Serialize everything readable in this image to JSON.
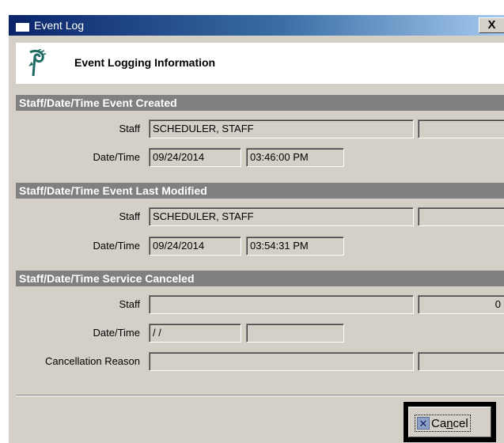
{
  "window": {
    "title": "Event Log",
    "close_label": "X"
  },
  "header": {
    "title": "Event Logging Information"
  },
  "sections": [
    {
      "title": "Staff/Date/Time Event Created",
      "staff_label": "Staff",
      "staff_value": "SCHEDULER, STAFF",
      "staff_extra": "",
      "datetime_label": "Date/Time",
      "date_value": "09/24/2014",
      "time_value": "03:46:00 PM"
    },
    {
      "title": "Staff/Date/Time Event Last Modified",
      "staff_label": "Staff",
      "staff_value": "SCHEDULER, STAFF",
      "staff_extra": "",
      "datetime_label": "Date/Time",
      "date_value": "09/24/2014",
      "time_value": "03:54:31 PM"
    },
    {
      "title": "Staff/Date/Time Service Canceled",
      "staff_label": "Staff",
      "staff_value": "",
      "staff_extra": "0",
      "datetime_label": "Date/Time",
      "date_value": " / /",
      "time_value": "",
      "reason_label": "Cancellation Reason",
      "reason_value": "",
      "reason_extra": ""
    }
  ],
  "footer": {
    "cancel_label_pre": "Ca",
    "cancel_label_underlined": "n",
    "cancel_label_post": "cel",
    "cancel_icon": "close-x-icon"
  }
}
